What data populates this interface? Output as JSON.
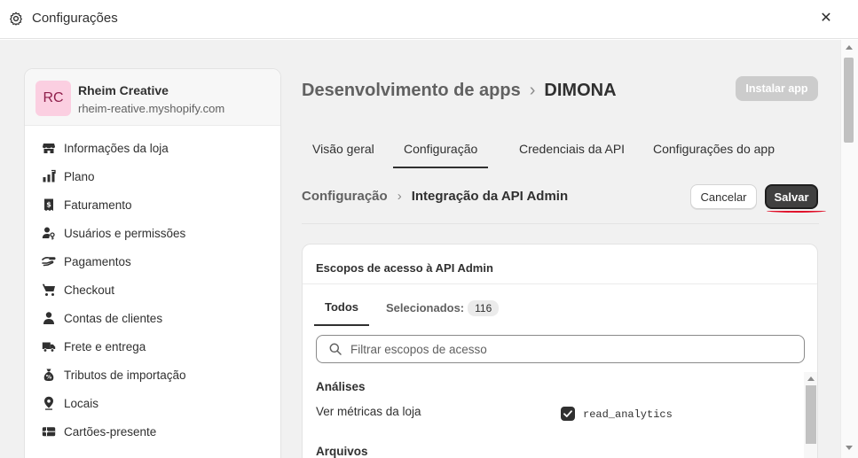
{
  "window": {
    "title": "Configurações"
  },
  "store": {
    "initials": "RC",
    "name": "Rheim Creative",
    "url": "rheim-reative.myshopify.com"
  },
  "sidebar": {
    "items": [
      {
        "label": "Informações da loja",
        "icon": "store-icon"
      },
      {
        "label": "Plano",
        "icon": "plan-icon"
      },
      {
        "label": "Faturamento",
        "icon": "receipt-icon"
      },
      {
        "label": "Usuários e permissões",
        "icon": "users-icon"
      },
      {
        "label": "Pagamentos",
        "icon": "payment-icon"
      },
      {
        "label": "Checkout",
        "icon": "cart-icon"
      },
      {
        "label": "Contas de clientes",
        "icon": "person-icon"
      },
      {
        "label": "Frete e entrega",
        "icon": "truck-icon"
      },
      {
        "label": "Tributos de importação",
        "icon": "tax-icon"
      },
      {
        "label": "Locais",
        "icon": "location-icon"
      },
      {
        "label": "Cartões-presente",
        "icon": "gift-card-icon"
      }
    ]
  },
  "header": {
    "parent": "Desenvolvimento de apps",
    "separator": "›",
    "current": "DIMONA",
    "install_label": "Instalar app"
  },
  "tabs": [
    {
      "label": "Visão geral",
      "active": false
    },
    {
      "label": "Configuração",
      "active": true
    },
    {
      "label": "Credenciais da API",
      "active": false
    },
    {
      "label": "Configurações do app",
      "active": false
    }
  ],
  "subheader": {
    "parent": "Configuração",
    "separator": "›",
    "current": "Integração da API Admin",
    "cancel_label": "Cancelar",
    "save_label": "Salvar"
  },
  "card": {
    "title": "Escopos de acesso à API Admin",
    "tab_all": "Todos",
    "tab_selected": "Selecionados:",
    "selected_count": "116",
    "search_placeholder": "Filtrar escopos de acesso",
    "section_1": "Análises",
    "row_1_label": "Ver métricas da loja",
    "row_1_scope": "read_analytics",
    "row_1_checked": true,
    "section_2": "Arquivos"
  },
  "colors": {
    "primary_button": "#404040",
    "highlight_underline": "#e0112a",
    "avatar_bg": "#fbcfe1"
  }
}
